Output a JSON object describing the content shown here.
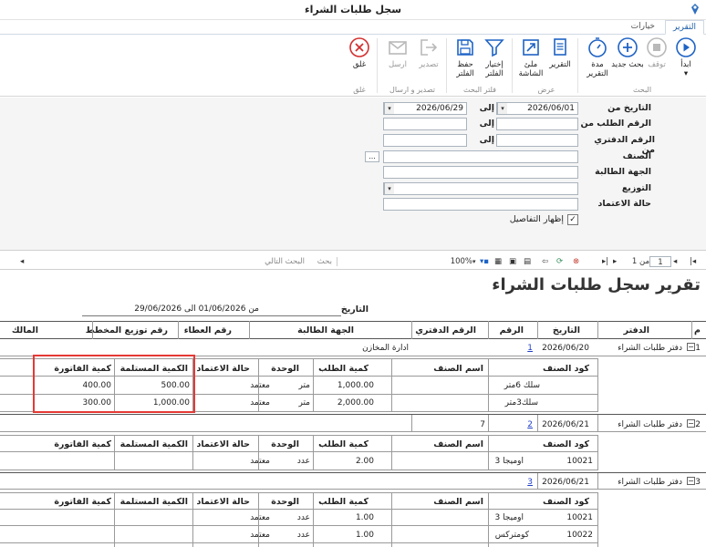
{
  "window": {
    "title": "سجل طلبات الشراء"
  },
  "tabs": [
    {
      "label": "التقرير"
    },
    {
      "label": "خيارات"
    }
  ],
  "ribbon": {
    "buttons": [
      {
        "label": "ابدأ",
        "icon": "play-icon"
      },
      {
        "label": "توقف",
        "icon": "stop-icon"
      },
      {
        "label": "بحث جديد",
        "icon": "plus-circle-icon"
      },
      {
        "label": "مدة التقرير",
        "icon": "stopwatch-icon"
      },
      {
        "label": "التقرير",
        "icon": "report-icon"
      },
      {
        "label": "ملئ الشاشة",
        "icon": "fullscreen-icon"
      },
      {
        "label": "إختيار الفلتر",
        "icon": "filter-icon"
      },
      {
        "label": "حفظ الفلتر",
        "icon": "save-icon"
      },
      {
        "label": "تصدير",
        "icon": "export-icon"
      },
      {
        "label": "ارسل",
        "icon": "mail-icon"
      },
      {
        "label": "غلق",
        "icon": "close-circle-icon"
      }
    ],
    "groups": [
      "البحث",
      "عرض",
      "فلتر البحث",
      "تصدير و ارسال",
      "غلق"
    ]
  },
  "filters": {
    "date_from_label": "التاريخ من",
    "date_from": "2026/06/01",
    "to_label": "إلى",
    "date_to": "2026/06/29",
    "request_no_label": "الرقم الطلب من",
    "book_no_label": "الرقم الدفتري من",
    "item_label": "الصنف",
    "item_button": "...",
    "requester_label": "الجهة الطالبة",
    "distribution_label": "التوزيع",
    "approval_label": "حالة الاعتماد",
    "show_details_label": "إظهار التفاصيل",
    "show_details_checked": true
  },
  "report_toolbar": {
    "page": "1",
    "of_label": "من 1",
    "zoom": "100%",
    "search_label": "بحث",
    "next_label": "البحث التالي"
  },
  "report": {
    "title": "تقرير سجل طلبات الشراء",
    "date_label": "التاريخ",
    "date_range": "من 01/06/2026 الى 29/06/2026",
    "headers": {
      "m": "م",
      "book": "الدفتر",
      "date": "التاريخ",
      "number": "الرقم",
      "book_number": "الرقم الدفتري",
      "requester": "الجهة الطالبة",
      "bid_number": "رقم العطاء",
      "plan_dist": "رقم توزيع المخطط",
      "owner": "المالك"
    },
    "detail_headers": {
      "code": "كود الصنف",
      "name": "اسم الصنف",
      "qty_req": "كمية الطلب",
      "unit": "الوحدة",
      "approval": "حالة الاعتماد",
      "qty_recv": "الكمية المستلمة",
      "qty_inv": "كمية الفاتورة"
    },
    "records": [
      {
        "m": "1",
        "book": "دفتر طلبات الشراء",
        "date": "2026/06/20",
        "number": "1",
        "book_number": "",
        "requester": "ادارة المخازن",
        "items": [
          {
            "code": "",
            "name": "سلك 6متر",
            "qty_req": "1,000.00",
            "unit": "متر",
            "approval": "معتمد",
            "qty_recv": "500.00",
            "qty_inv": "400.00"
          },
          {
            "code": "",
            "name": "سلك3متر",
            "qty_req": "2,000.00",
            "unit": "متر",
            "approval": "معتمد",
            "qty_recv": "1,000.00",
            "qty_inv": "300.00"
          }
        ]
      },
      {
        "m": "2",
        "book": "دفتر طلبات الشراء",
        "date": "2026/06/21",
        "number": "2",
        "book_number": "7",
        "requester": "",
        "items": [
          {
            "code": "10021",
            "name": "اوميجا 3",
            "qty_req": "2.00",
            "unit": "عدد",
            "approval": "معتمد",
            "qty_recv": "",
            "qty_inv": ""
          }
        ]
      },
      {
        "m": "3",
        "book": "دفتر طلبات الشراء",
        "date": "2026/06/21",
        "number": "3",
        "book_number": "",
        "requester": "",
        "items": [
          {
            "code": "10021",
            "name": "اوميجا 3",
            "qty_req": "1.00",
            "unit": "عدد",
            "approval": "معتمد",
            "qty_recv": "",
            "qty_inv": ""
          },
          {
            "code": "10022",
            "name": "كومتركس",
            "qty_req": "1.00",
            "unit": "عدد",
            "approval": "معتمد",
            "qty_recv": "",
            "qty_inv": ""
          }
        ]
      }
    ],
    "extra_row": {
      "unit": "عدد",
      "approval": "معتمد",
      "qty_req": "1.00"
    }
  }
}
